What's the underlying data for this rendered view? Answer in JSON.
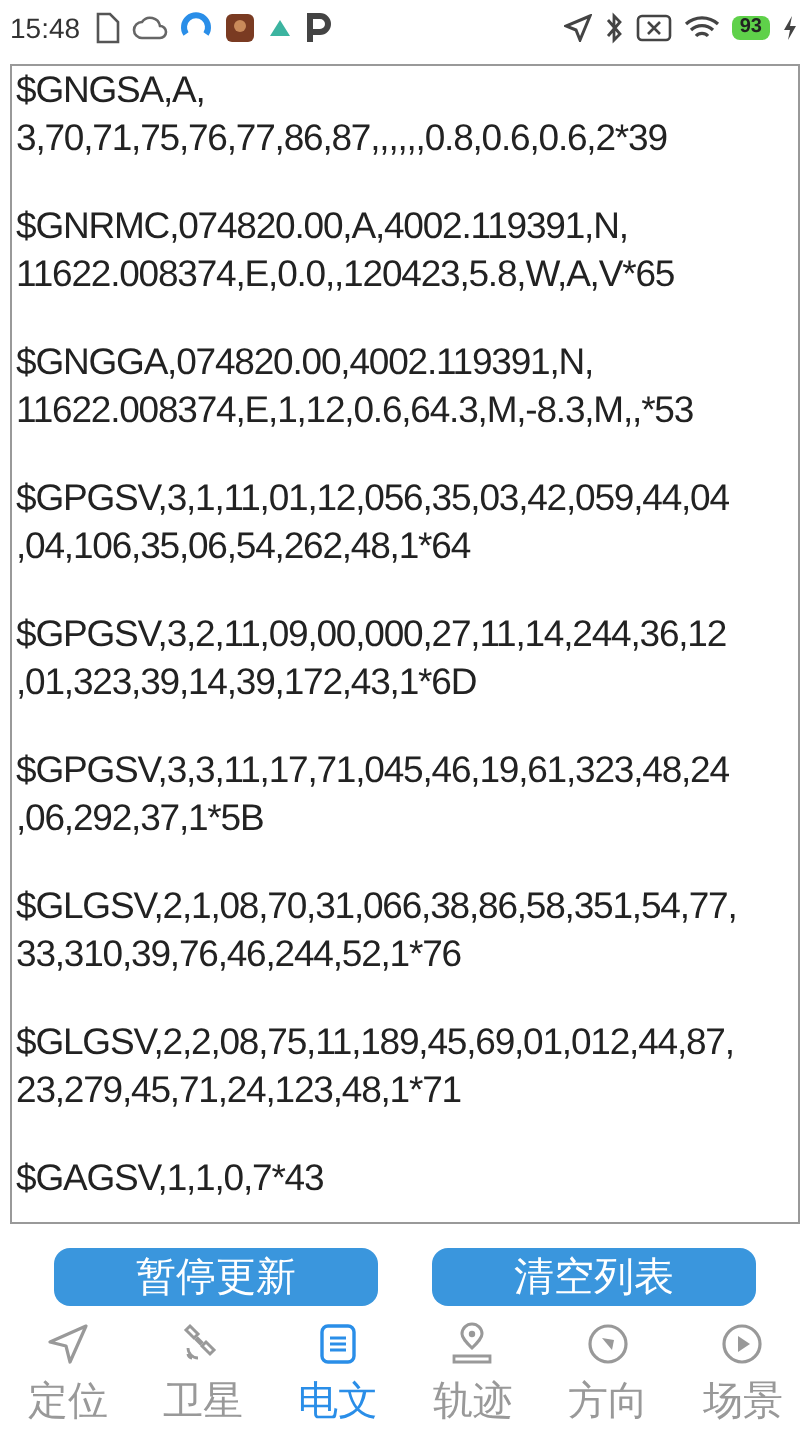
{
  "status_bar": {
    "time": "15:48",
    "battery": "93"
  },
  "messages": [
    {
      "lines": [
        "$GNGSA,A,",
        "3,70,71,75,76,77,86,87,,,,,,0.8,0.6,0.6,2*39"
      ]
    },
    {
      "lines": [
        "$GNRMC,074820.00,A,4002.119391,N,",
        "11622.008374,E,0.0,,120423,5.8,W,A,V*65"
      ]
    },
    {
      "lines": [
        "$GNGGA,074820.00,4002.119391,N,",
        "11622.008374,E,1,12,0.6,64.3,M,-8.3,M,,*53"
      ]
    },
    {
      "lines": [
        "$GPGSV,3,1,11,01,12,056,35,03,42,059,44,04",
        ",04,106,35,06,54,262,48,1*64"
      ]
    },
    {
      "lines": [
        "$GPGSV,3,2,11,09,00,000,27,11,14,244,36,12",
        ",01,323,39,14,39,172,43,1*6D"
      ]
    },
    {
      "lines": [
        "$GPGSV,3,3,11,17,71,045,46,19,61,323,48,24",
        ",06,292,37,1*5B"
      ]
    },
    {
      "lines": [
        "$GLGSV,2,1,08,70,31,066,38,86,58,351,54,77,",
        "33,310,39,76,46,244,52,1*76"
      ]
    },
    {
      "lines": [
        "$GLGSV,2,2,08,75,11,189,45,69,01,012,44,87,",
        "23,279,45,71,24,123,48,1*71"
      ]
    },
    {
      "lines": [
        "$GAGSV,1,1,0,7*43"
      ]
    }
  ],
  "buttons": [
    {
      "label": "暂停更新"
    },
    {
      "label": "清空列表"
    }
  ],
  "nav": [
    {
      "label": "定位",
      "kind": "locate",
      "selected": false
    },
    {
      "label": "卫星",
      "kind": "satellite",
      "selected": false
    },
    {
      "label": "电文",
      "kind": "message",
      "selected": true
    },
    {
      "label": "轨迹",
      "kind": "track",
      "selected": false
    },
    {
      "label": "方向",
      "kind": "compass",
      "selected": false
    },
    {
      "label": "场景",
      "kind": "scene",
      "selected": false
    }
  ]
}
